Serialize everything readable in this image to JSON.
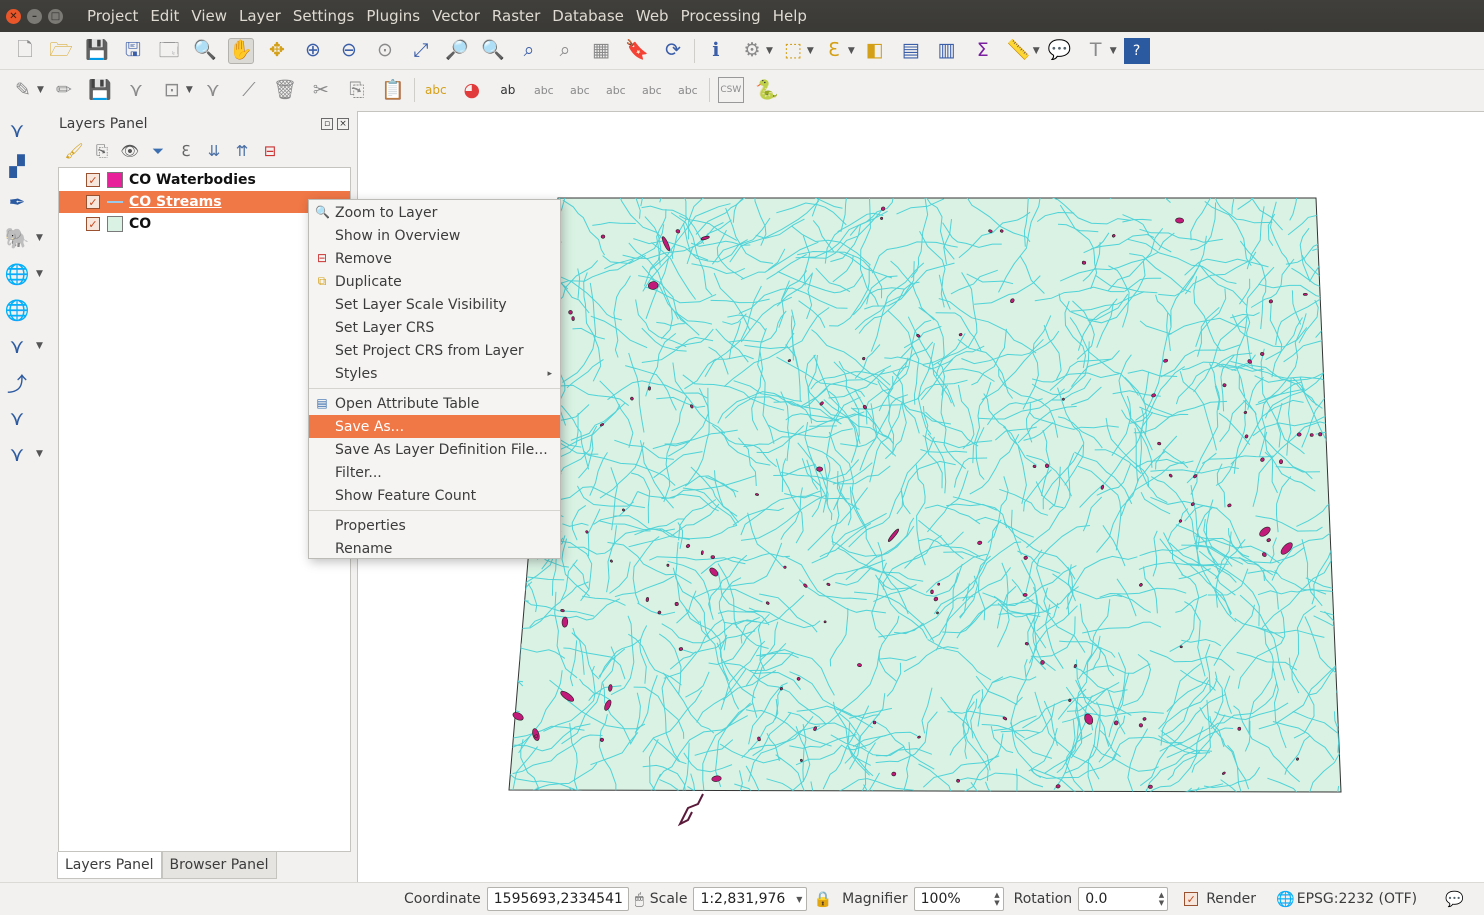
{
  "menubar": {
    "items": [
      "Project",
      "Edit",
      "View",
      "Layer",
      "Settings",
      "Plugins",
      "Vector",
      "Raster",
      "Database",
      "Web",
      "Processing",
      "Help"
    ]
  },
  "layers_panel": {
    "title": "Layers Panel",
    "layers": [
      {
        "name": "CO Waterbodies",
        "checked": true,
        "swatch": "#e8209a",
        "selected": false
      },
      {
        "name": "CO Streams",
        "checked": true,
        "swatch": "#9bc9ea",
        "selected": true
      },
      {
        "name": "CO",
        "checked": true,
        "swatch": "#d9f2e3",
        "selected": false
      }
    ],
    "tabs": [
      "Layers Panel",
      "Browser Panel"
    ]
  },
  "context_menu": {
    "items": [
      {
        "label": "Zoom to Layer",
        "icon": "zoom-icon"
      },
      {
        "label": "Show in Overview"
      },
      {
        "label": "Remove",
        "icon": "remove-icon"
      },
      {
        "label": "Duplicate",
        "icon": "duplicate-icon"
      },
      {
        "label": "Set Layer Scale Visibility"
      },
      {
        "label": "Set Layer CRS"
      },
      {
        "label": "Set Project CRS from Layer"
      },
      {
        "label": "Styles",
        "submenu": true
      },
      {
        "separator": true
      },
      {
        "label": "Open Attribute Table",
        "icon": "table-icon"
      },
      {
        "label": "Save As...",
        "highlighted": true
      },
      {
        "label": "Save As Layer Definition File..."
      },
      {
        "label": "Filter..."
      },
      {
        "label": "Show Feature Count"
      },
      {
        "separator": true
      },
      {
        "label": "Properties"
      },
      {
        "label": "Rename"
      }
    ]
  },
  "statusbar": {
    "coordinate_label": "Coordinate",
    "coordinate_value": "1595693,2334541",
    "scale_label": "Scale",
    "scale_value": "1:2,831,976",
    "magnifier_label": "Magnifier",
    "magnifier_value": "100%",
    "rotation_label": "Rotation",
    "rotation_value": "0.0",
    "render_label": "Render",
    "render_checked": true,
    "crs_label": "EPSG:2232 (OTF)"
  },
  "colors": {
    "accent": "#f07746",
    "state_fill": "#d9f2e3",
    "streams": "#4fd3d8",
    "waterbodies": "#e8209a",
    "menubar": "#3c3b37"
  }
}
